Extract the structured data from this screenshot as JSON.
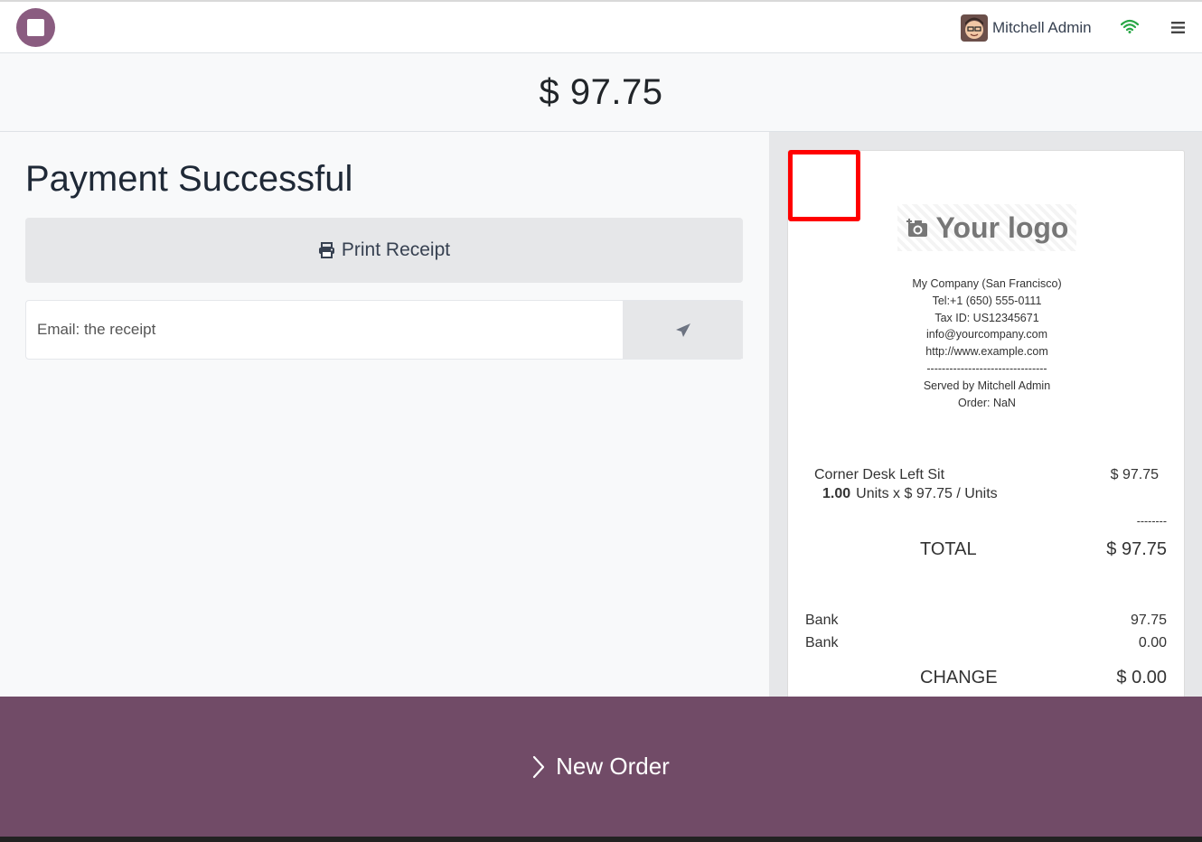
{
  "header": {
    "user_name": "Mitchell Admin",
    "app_icon": "pos-app-icon",
    "wifi_icon": "wifi-icon",
    "menu_icon": "hamburger-menu-icon"
  },
  "order": {
    "amount": "$ 97.75"
  },
  "payment": {
    "title": "Payment Successful",
    "print_label": "Print Receipt",
    "email_placeholder": "Email: the receipt",
    "send_icon": "paper-plane-icon"
  },
  "receipt": {
    "logo_text": "Your logo",
    "company_lines": [
      "My Company (San Francisco)",
      "Tel:+1 (650) 555-0111",
      "Tax ID: US12345671",
      "info@yourcompany.com",
      "http://www.example.com",
      "--------------------------------",
      "Served by Mitchell Admin",
      "Order: NaN"
    ],
    "line": {
      "product": "Corner Desk Left Sit",
      "price": "$ 97.75",
      "qty": "1.00",
      "unit_detail": "Units x $ 97.75 / Units"
    },
    "separator": "--------",
    "total_label": "TOTAL",
    "total_value": "$ 97.75",
    "payments": [
      {
        "method": "Bank",
        "amount": "97.75"
      },
      {
        "method": "Bank",
        "amount": "0.00"
      }
    ],
    "change_label": "CHANGE",
    "change_value": "$ 0.00"
  },
  "footer": {
    "new_order_label": "New Order"
  },
  "colors": {
    "brand": "#714b67",
    "highlight": "#ff0000",
    "wifi": "#28a745"
  }
}
